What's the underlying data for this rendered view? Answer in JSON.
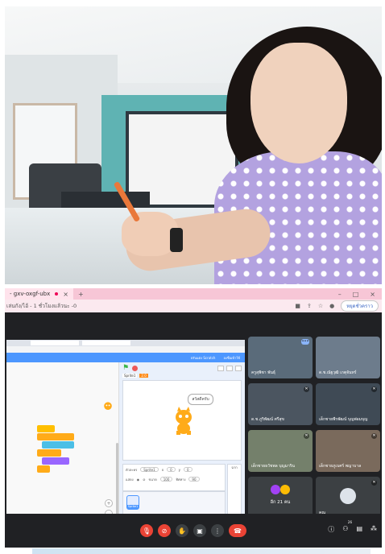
{
  "browser": {
    "tab_title": "- gxv-oxgf-ubx",
    "tab_close": "×",
    "tab_add": "+",
    "url": "เล่นกัง/ไอ้ - 1 ชั่วโมงแล้วนะ -0",
    "window_minimize": "–",
    "window_maximize": "□",
    "window_close": "×",
    "profile_label": "หยุดชั่วคราว"
  },
  "shared_screen": {
    "header_links": [
      "ปรับแต่ง Scratch",
      "ลงชื่อเข้าใช้"
    ],
    "sprite_label": "Sprite1",
    "stage_tag": "2.0",
    "speech_bubble": "สวัสดีครับ",
    "sprite_field_label": "ตัวละคร",
    "sprite_name_value": "Sprite1",
    "x_label": "x",
    "x_value": "0",
    "y_label": "y",
    "y_value": "0",
    "show_label": "แสดง",
    "size_label": "ขนาด",
    "size_value": "100",
    "direction_label": "ทิศทาง",
    "direction_value": "90",
    "backdrop_label": "ฉาก",
    "thumb_name": "Sprite1",
    "zoom_in": "+",
    "zoom_out": "−",
    "zoom_reset": "="
  },
  "participants": [
    {
      "name": "ครูสุพิชา พันธุ์",
      "more": "•••"
    },
    {
      "name": "ด.ช.ณัฐวุฒิ เกตุจันทร์"
    },
    {
      "name": "ด.ช.ภูริพัฒน์ ศรีสุข"
    },
    {
      "name": "เด็กชายพีรพัฒน์ บุญพ่อมบุญ"
    },
    {
      "name": "เด็กชายธวัชพล บุญมาริน"
    },
    {
      "name": "เด็กชายภูเบศร์ พญาบาล"
    },
    {
      "name": "",
      "others": "อีก 21 คน"
    },
    {
      "name": "คุณ"
    }
  ],
  "controls": {
    "mic": "🎙",
    "cam": "⊘",
    "hand": "✋",
    "present": "▣",
    "more": "⋮",
    "end": "☎",
    "info": "ⓘ",
    "people": "⚇",
    "chat": "▤",
    "activities": "⁂",
    "people_count": "26"
  },
  "colors": {
    "meet_bg": "#202124",
    "end_call": "#ea4335",
    "scratch_blue": "#4d97ff",
    "tab_pink": "#f7c6d6"
  }
}
